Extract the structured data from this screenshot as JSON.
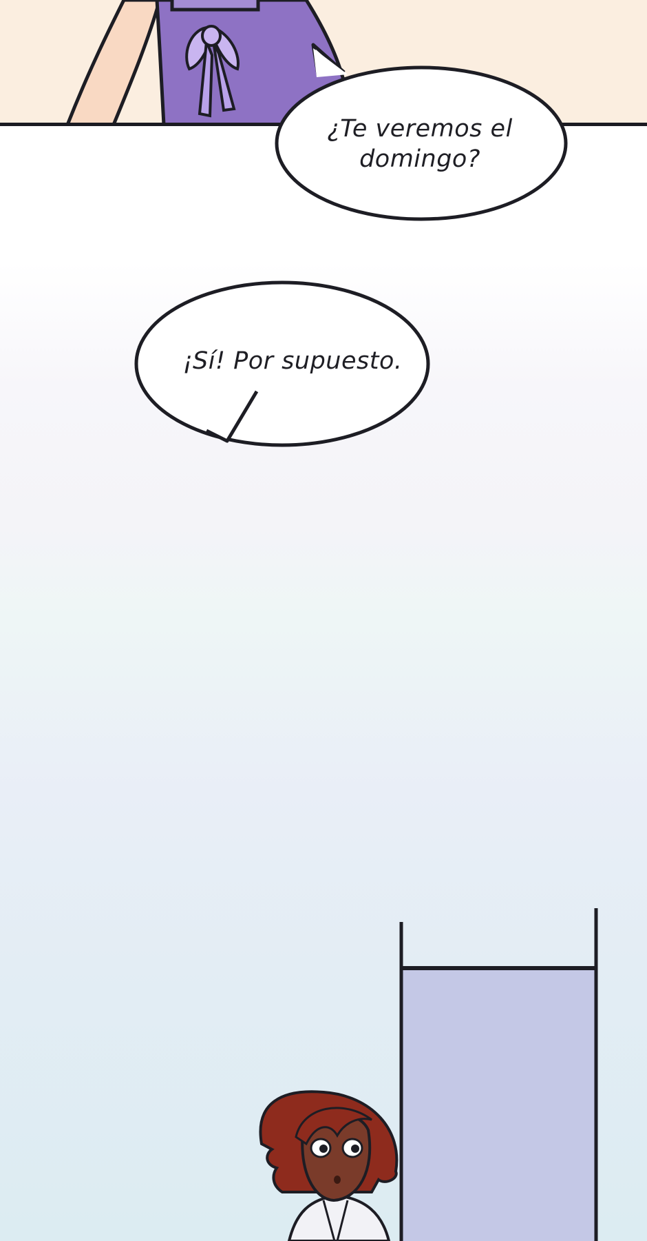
{
  "panels": {
    "top": {
      "background": "#fbeee0",
      "apron_color": "#8e72c4"
    },
    "middle": {
      "background": "#ffffff"
    },
    "bottom": {
      "doorway_color": "#c4c8e6",
      "sky_top": "#f4f4f8",
      "sky_bottom": "#dcecf2"
    }
  },
  "dialogue": [
    {
      "speaker": "",
      "text": "¿Te veremos el domingo?"
    },
    {
      "speaker": "",
      "text": "¡Sí! Por supuesto."
    }
  ]
}
